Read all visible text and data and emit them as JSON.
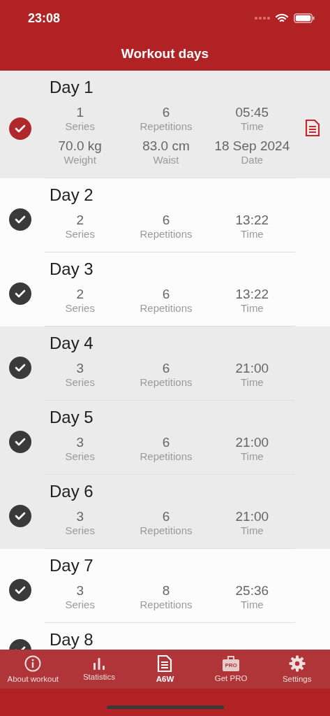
{
  "status_bar": {
    "time": "23:08"
  },
  "header": {
    "title": "Workout days"
  },
  "days": [
    {
      "title": "Day 1",
      "current": true,
      "shaded": true,
      "stats": [
        {
          "value": "1",
          "label": "Series"
        },
        {
          "value": "6",
          "label": "Repetitions"
        },
        {
          "value": "05:45",
          "label": "Time"
        },
        {
          "value": "70.0 kg",
          "label": "Weight"
        },
        {
          "value": "83.0 cm",
          "label": "Waist"
        },
        {
          "value": "18 Sep 2024",
          "label": "Date"
        }
      ]
    },
    {
      "title": "Day 2",
      "current": false,
      "shaded": false,
      "stats": [
        {
          "value": "2",
          "label": "Series"
        },
        {
          "value": "6",
          "label": "Repetitions"
        },
        {
          "value": "13:22",
          "label": "Time"
        }
      ]
    },
    {
      "title": "Day 3",
      "current": false,
      "shaded": false,
      "stats": [
        {
          "value": "2",
          "label": "Series"
        },
        {
          "value": "6",
          "label": "Repetitions"
        },
        {
          "value": "13:22",
          "label": "Time"
        }
      ]
    },
    {
      "title": "Day 4",
      "current": false,
      "shaded": true,
      "stats": [
        {
          "value": "3",
          "label": "Series"
        },
        {
          "value": "6",
          "label": "Repetitions"
        },
        {
          "value": "21:00",
          "label": "Time"
        }
      ]
    },
    {
      "title": "Day 5",
      "current": false,
      "shaded": true,
      "stats": [
        {
          "value": "3",
          "label": "Series"
        },
        {
          "value": "6",
          "label": "Repetitions"
        },
        {
          "value": "21:00",
          "label": "Time"
        }
      ]
    },
    {
      "title": "Day 6",
      "current": false,
      "shaded": true,
      "stats": [
        {
          "value": "3",
          "label": "Series"
        },
        {
          "value": "6",
          "label": "Repetitions"
        },
        {
          "value": "21:00",
          "label": "Time"
        }
      ]
    },
    {
      "title": "Day 7",
      "current": false,
      "shaded": false,
      "stats": [
        {
          "value": "3",
          "label": "Series"
        },
        {
          "value": "8",
          "label": "Repetitions"
        },
        {
          "value": "25:36",
          "label": "Time"
        }
      ]
    },
    {
      "title": "Day 8",
      "current": false,
      "shaded": false
    }
  ],
  "tab_bar": [
    {
      "kind": "info",
      "label": "About workout",
      "selected": false
    },
    {
      "kind": "stats",
      "label": "Statistics",
      "selected": false
    },
    {
      "kind": "doc",
      "label": "A6W",
      "selected": true
    },
    {
      "kind": "pro",
      "label": "Get PRO",
      "badge": "PRO",
      "selected": false
    },
    {
      "kind": "gear",
      "label": "Settings",
      "selected": false
    }
  ]
}
